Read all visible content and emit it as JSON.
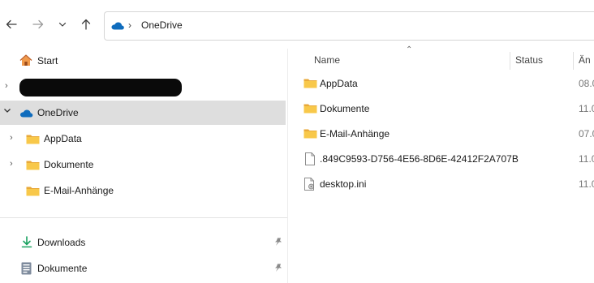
{
  "address_bar": {
    "location": "OneDrive",
    "icon": "onedrive-cloud-icon"
  },
  "navigation": {
    "back_icon": "back-arrow-icon",
    "forward_icon": "forward-arrow-icon",
    "recent_icon": "chevron-down-icon",
    "up_icon": "up-arrow-icon"
  },
  "sidebar": {
    "home": "Start",
    "redacted_account": "",
    "onedrive": "OneDrive",
    "folders": [
      "AppData",
      "Dokumente",
      "E-Mail-Anhänge"
    ],
    "quick_access": [
      "Downloads",
      "Dokumente"
    ]
  },
  "file_list": {
    "columns": [
      "Name",
      "Status",
      "Än"
    ],
    "rows": [
      {
        "name": "AppData",
        "date": "08.0",
        "type": "folder"
      },
      {
        "name": "Dokumente",
        "date": "11.0",
        "type": "folder"
      },
      {
        "name": "E-Mail-Anhänge",
        "date": "07.0",
        "type": "folder"
      },
      {
        "name": ".849C9593-D756-4E56-8D6E-42412F2A707B",
        "date": "11.0",
        "type": "file"
      },
      {
        "name": "desktop.ini",
        "date": "11.0",
        "type": "settings-file"
      }
    ]
  },
  "colors": {
    "folder_yellow": "#f8c84a",
    "onedrive_blue": "#0f6cbd",
    "selected_bg": "#dedede",
    "download_green": "#1aa260"
  }
}
